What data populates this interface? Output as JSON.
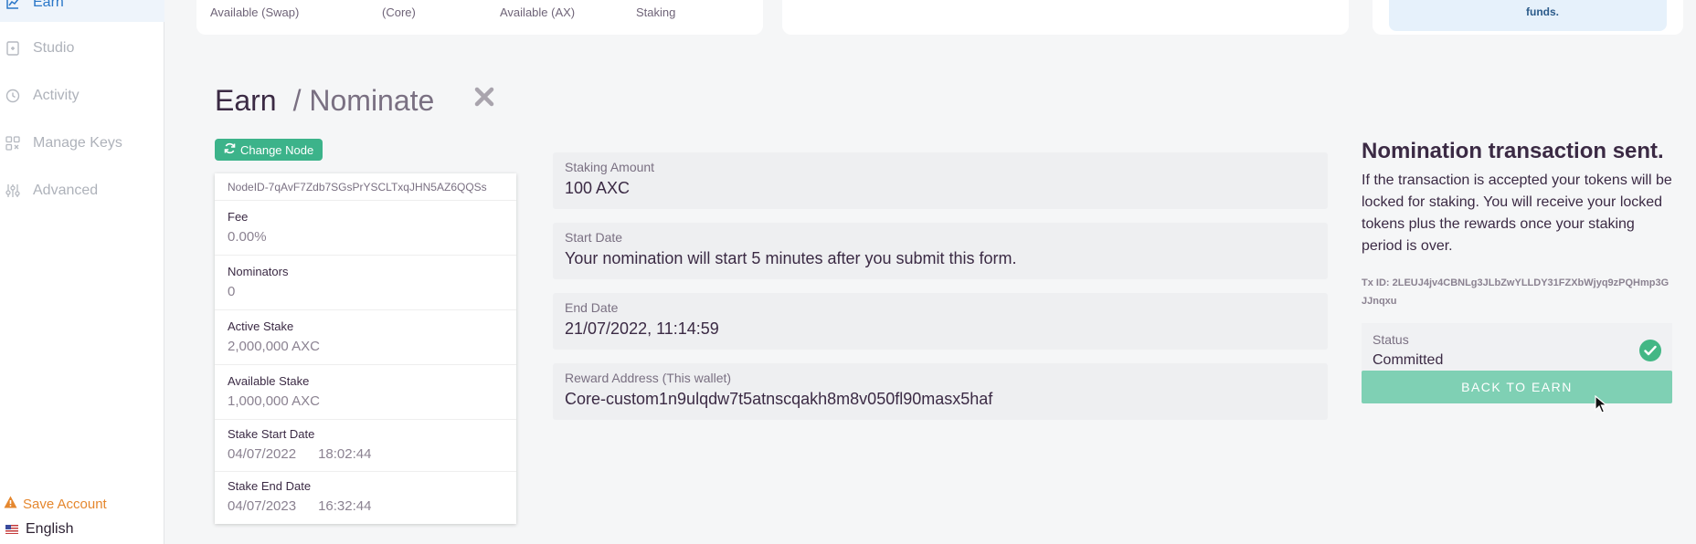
{
  "sidebar": {
    "items": [
      {
        "label": "Earn",
        "icon": "chart-line-icon",
        "active": true
      },
      {
        "label": "Studio",
        "icon": "document-icon"
      },
      {
        "label": "Activity",
        "icon": "clock-icon"
      },
      {
        "label": "Manage Keys",
        "icon": "key-grid-icon"
      },
      {
        "label": "Advanced",
        "icon": "sliders-icon"
      }
    ],
    "save_account": "Save Account",
    "language": "English"
  },
  "top_cards": {
    "labels": [
      "Available (Swap)",
      "(Core)",
      "Available (AX)",
      "Staking"
    ],
    "info_text": "funds."
  },
  "page": {
    "title": "Earn",
    "subtitle": "/ Nominate",
    "change_node": "Change Node"
  },
  "node": {
    "id": "NodeID-7qAvF7Zdb7SGsPrYSCLTxqJHN5AZ6QQSs",
    "fee_label": "Fee",
    "fee": "0.00%",
    "nominators_label": "Nominators",
    "nominators": "0",
    "active_stake_label": "Active Stake",
    "active_stake": "2,000,000 AXC",
    "available_stake_label": "Available Stake",
    "available_stake": "1,000,000 AXC",
    "start_label": "Stake Start Date",
    "start_date": "04/07/2022",
    "start_time": "18:02:44",
    "end_label": "Stake End Date",
    "end_date": "04/07/2023",
    "end_time": "16:32:44"
  },
  "form": {
    "amount_label": "Staking Amount",
    "amount": "100 AXC",
    "start_label": "Start Date",
    "start": "Your nomination will start 5 minutes after you submit this form.",
    "end_label": "End Date",
    "end": "21/07/2022, 11:14:59",
    "reward_label": "Reward Address (This wallet)",
    "reward": "Core-custom1n9ulqdw7t5atnscqakh8m8v050fl90masx5haf"
  },
  "result": {
    "title": "Nomination transaction sent.",
    "description": "If the transaction is accepted your tokens will be locked for staking. You will receive your locked tokens plus the rewards once your staking period is over.",
    "tx": "Tx ID: 2LEUJ4jv4CBNLg3JLbZwYLLDY31FZXbWjyq9zPQHmp3GJJnqxu",
    "status_label": "Status",
    "status": "Committed",
    "back_button": "BACK TO EARN"
  },
  "colors": {
    "accent_green": "#3cb38a",
    "button_green": "#7fd0b4",
    "save_orange": "#e5872e"
  }
}
